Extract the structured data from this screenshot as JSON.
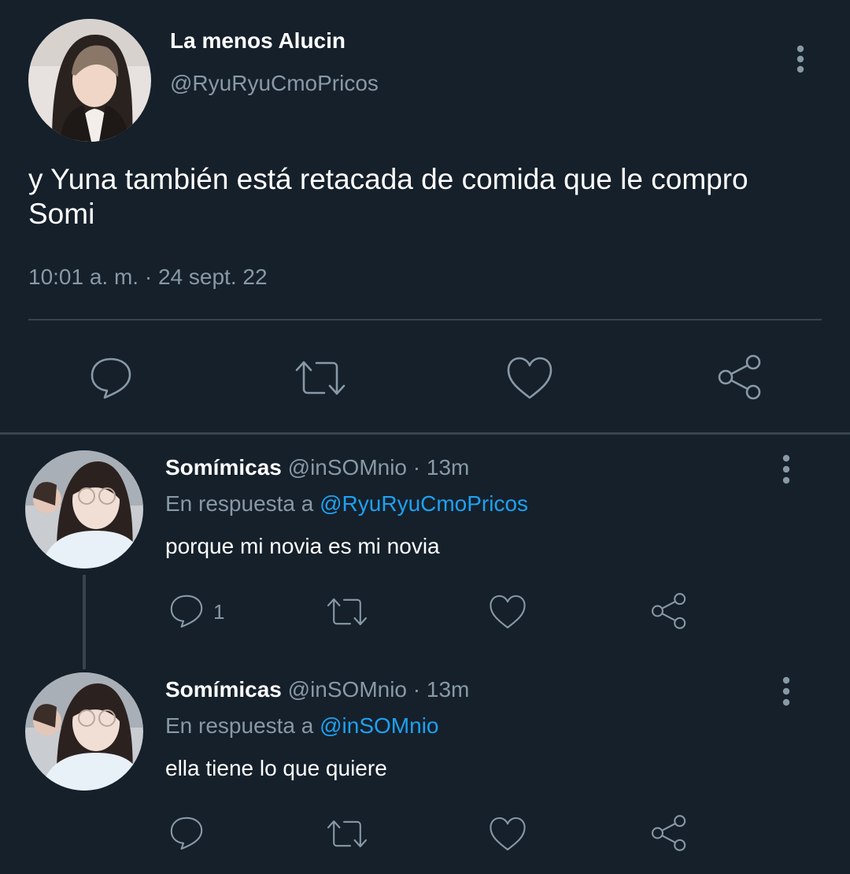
{
  "main_tweet": {
    "name": "La menos Alucin",
    "handle": "@RyuRyuCmoPricos",
    "text": "y Yuna también está retacada de comida que le compro Somi",
    "timestamp": "10:01 a. m. · 24 sept. 22",
    "actions": [
      "reply-icon",
      "retweet-icon",
      "like-icon",
      "share-icon"
    ]
  },
  "replies": [
    {
      "name": "Somímicas",
      "handle": "@inSOMnio",
      "time": "13m",
      "reply_prefix": "En respuesta a",
      "reply_to": "@RyuRyuCmoPricos",
      "text": "porque mi novia es mi novia",
      "reply_count": "1"
    },
    {
      "name": "Somímicas",
      "handle": "@inSOMnio",
      "time": "13m",
      "reply_prefix": "En respuesta a",
      "reply_to": "@inSOMnio",
      "text": "ella tiene lo que quiere",
      "reply_count": ""
    }
  ],
  "colors": {
    "background": "#15202b",
    "secondary_text": "#8899a6",
    "link": "#1da1f2",
    "divider": "#38444d"
  }
}
